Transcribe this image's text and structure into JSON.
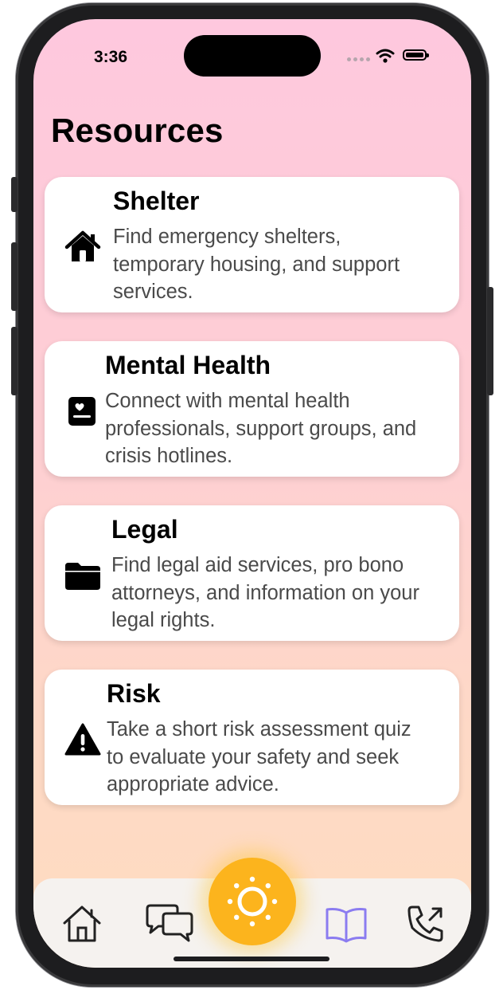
{
  "status_bar": {
    "time": "3:36"
  },
  "page": {
    "title": "Resources"
  },
  "resources": [
    {
      "title": "Shelter",
      "description": "Find emergency shelters, temporary housing, and support services.",
      "icon": "house-icon"
    },
    {
      "title": "Mental Health",
      "description": "Connect with mental health professionals, support groups, and crisis hotlines.",
      "icon": "heart-clipboard-icon"
    },
    {
      "title": "Legal",
      "description": "Find legal aid services, pro bono attorneys, and information on your legal rights.",
      "icon": "folder-icon"
    },
    {
      "title": "Risk",
      "description": "Take a short risk assessment quiz to evaluate your safety and seek appropriate advice.",
      "icon": "warning-triangle-icon"
    }
  ],
  "tab_bar": {
    "tabs": [
      {
        "icon": "home-icon",
        "active": false
      },
      {
        "icon": "chat-bubbles-icon",
        "active": false
      },
      {
        "icon": "sun-icon",
        "active": false,
        "center": true
      },
      {
        "icon": "book-icon",
        "active": true
      },
      {
        "icon": "phone-outgoing-icon",
        "active": false
      }
    ]
  },
  "colors": {
    "background_top": "#fec8de",
    "background_bottom": "#fedcc0",
    "card_background": "#ffffff",
    "accent_yellow": "#fcb41d",
    "active_tab": "#8b7cf0",
    "tab_bar": "#f5f2ef"
  }
}
